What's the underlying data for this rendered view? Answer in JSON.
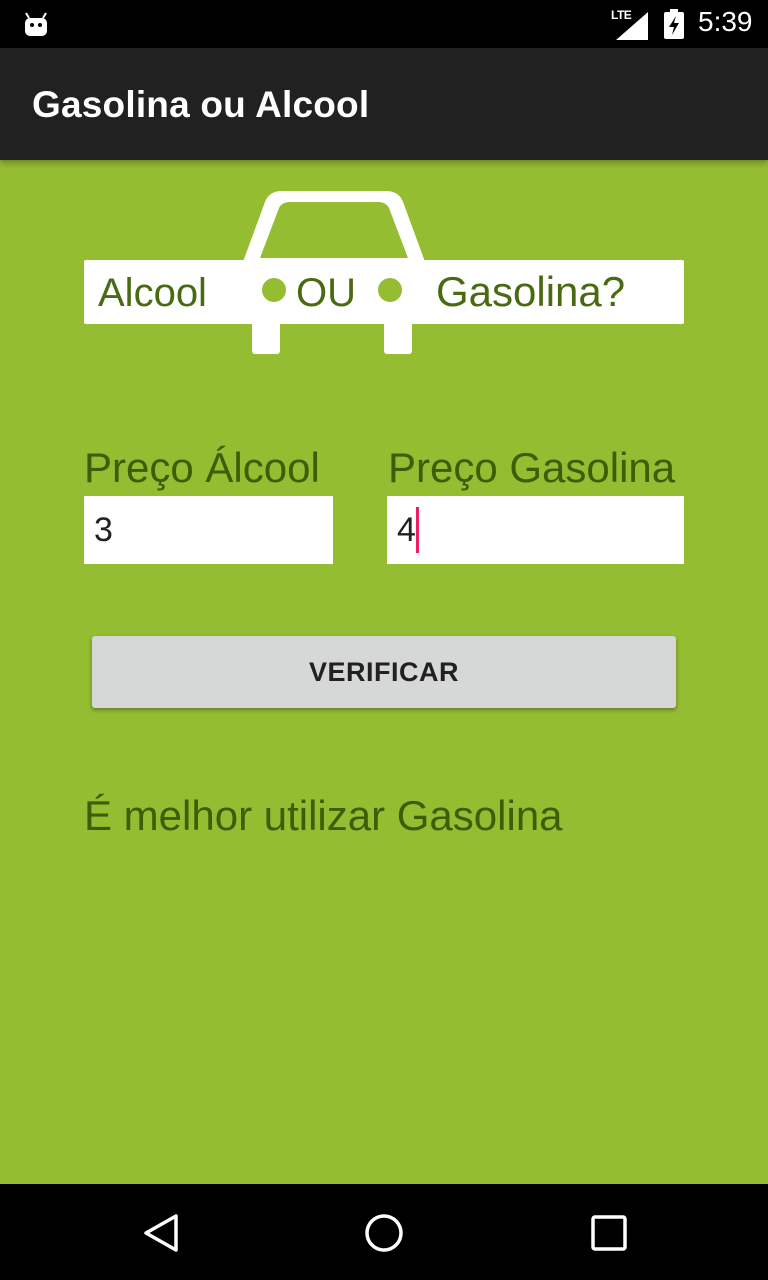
{
  "status_bar": {
    "network": "LTE",
    "time": "5:39",
    "icons": [
      "android-icon",
      "lte-signal-icon",
      "battery-charging-icon"
    ]
  },
  "app_bar": {
    "title": "Gasolina ou Alcool"
  },
  "logo": {
    "left_word": "Alcool",
    "middle_word": "OU",
    "right_word": "Gasolina?"
  },
  "form": {
    "alcohol_label": "Preço Álcool",
    "alcohol_value": "3",
    "gasoline_label": "Preço Gasolina",
    "gasoline_value": "4",
    "verify_button": "VERIFICAR"
  },
  "result": {
    "text": "É melhor utilizar Gasolina"
  },
  "nav_bar": {
    "icons": [
      "back-icon",
      "home-icon",
      "recents-icon"
    ]
  },
  "colors": {
    "background": "#95bd32",
    "app_bar": "#212121",
    "label_text": "#3e5d06",
    "button": "#d6d7d7",
    "cursor": "#e91e63"
  }
}
